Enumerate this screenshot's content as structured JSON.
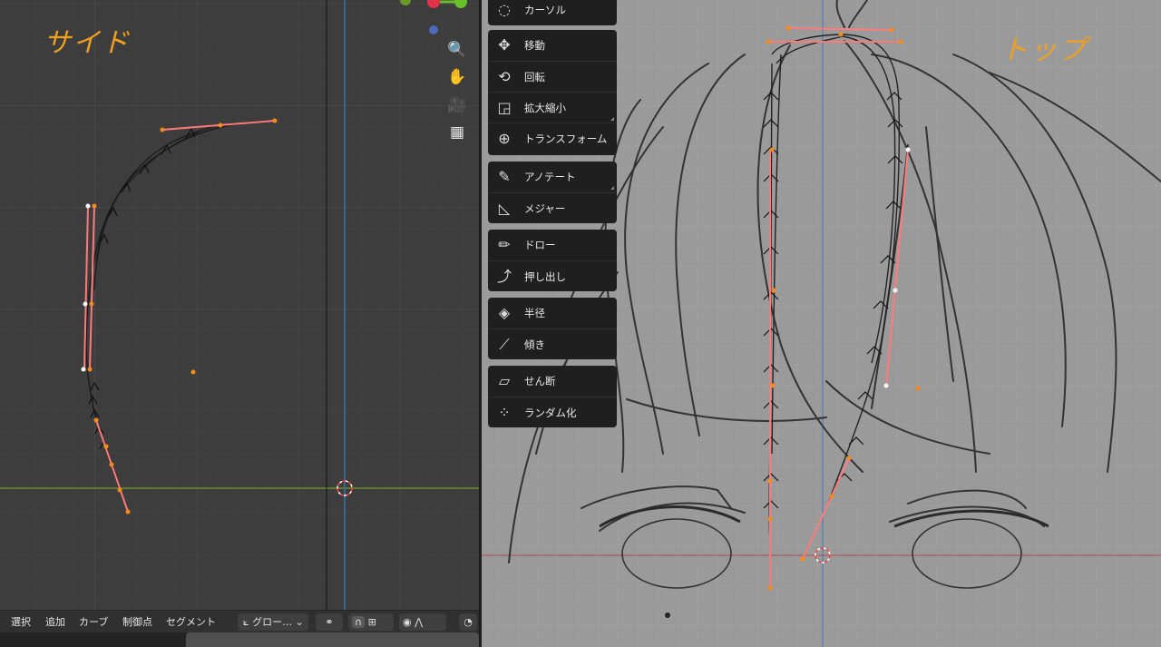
{
  "left_viewport": {
    "annotation": "サイド",
    "menu": [
      "選択",
      "追加",
      "カーブ",
      "制御点",
      "セグメント"
    ],
    "orientation_label": "グロー…",
    "colors": {
      "bg": "#3d3d3d",
      "grid": "#474747",
      "handle": "#ff7b7b",
      "point": "#ff8a1c",
      "curve": "#1a1a1a"
    }
  },
  "right_viewport": {
    "annotation": "トップ",
    "toolbar": [
      {
        "icon": "cursor-icon",
        "label": "カーソル"
      },
      {
        "icon": "move-icon",
        "label": "移動"
      },
      {
        "icon": "rotate-icon",
        "label": "回転"
      },
      {
        "icon": "scale-icon",
        "label": "拡大縮小"
      },
      {
        "icon": "transform-icon",
        "label": "トランスフォーム"
      },
      {
        "icon": "annotate-icon",
        "label": "アノテート"
      },
      {
        "icon": "measure-icon",
        "label": "メジャー"
      },
      {
        "icon": "draw-icon",
        "label": "ドロー"
      },
      {
        "icon": "extrude-icon",
        "label": "押し出し"
      },
      {
        "icon": "radius-icon",
        "label": "半径"
      },
      {
        "icon": "tilt-icon",
        "label": "傾き"
      },
      {
        "icon": "shear-icon",
        "label": "せん断"
      },
      {
        "icon": "randomize-icon",
        "label": "ランダム化"
      }
    ],
    "colors": {
      "bg": "#9a9a9a",
      "grid": "#a3a3a3",
      "sketch": "#333333"
    }
  },
  "nav_icons": [
    "zoom-icon",
    "hand-icon",
    "camera-icon",
    "grid-icon"
  ]
}
